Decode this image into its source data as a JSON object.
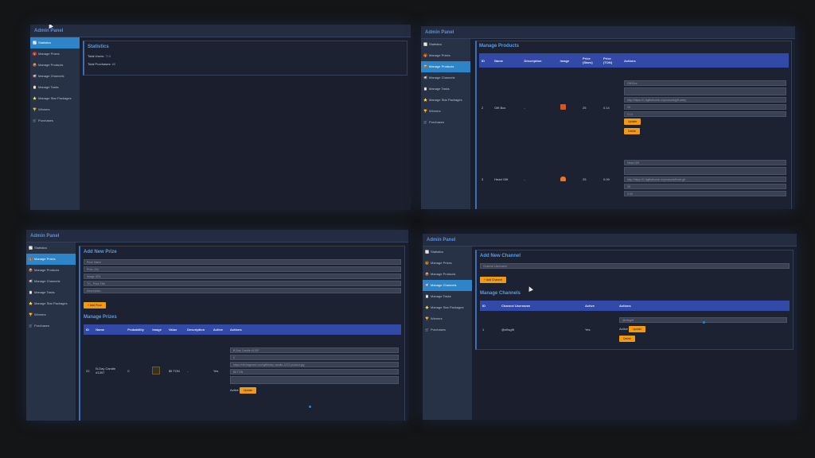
{
  "app_title": "Admin Panel",
  "sidebar": [
    {
      "icon": "chart-icon",
      "glyph": "📈",
      "label": "Statistics"
    },
    {
      "icon": "gift-icon",
      "glyph": "🎁",
      "label": "Manage Prizes"
    },
    {
      "icon": "box-icon",
      "glyph": "📦",
      "label": "Manage Products"
    },
    {
      "icon": "megaphone-icon",
      "glyph": "📢",
      "label": "Manage Channels"
    },
    {
      "icon": "tasks-icon",
      "glyph": "📋",
      "label": "Manage Tasks"
    },
    {
      "icon": "star-icon",
      "glyph": "⭐",
      "label": "Manage Star Packages"
    },
    {
      "icon": "trophy-icon",
      "glyph": "🏆",
      "label": "Winners"
    },
    {
      "icon": "cart-icon",
      "glyph": "🛒",
      "label": "Purchases"
    }
  ],
  "statistics": {
    "title": "Statistics",
    "total_users_label": "Total Users:",
    "total_users_value": "713",
    "total_purchases_label": "Total Purchases:",
    "total_purchases_value": "85"
  },
  "products": {
    "title": "Manage Products",
    "columns": [
      "ID",
      "Name",
      "Description",
      "Image",
      "Price (Stars)",
      "Price (TON)",
      "Actions"
    ],
    "rows": [
      {
        "id": "2",
        "name": "Gift Box",
        "description": "-",
        "image": "gift-icon",
        "price_stars": "25",
        "price_ton": "0.14",
        "inputs": [
          "Gift Box",
          "",
          "http://https://i1.tlgiftsthumb.ru/products/gift.webp",
          "25",
          "0.14"
        ],
        "update_label": "Update",
        "delete_label": "Delete"
      },
      {
        "id": "3",
        "name": "Heart Gift",
        "description": "-",
        "image": "heart-icon",
        "price_stars": "25",
        "price_ton": "0.09",
        "inputs": [
          "Heart Gift",
          "",
          "http://https://i1.tlgiftsthumb.ru/products/heart.gif",
          "25",
          "0.09"
        ]
      }
    ]
  },
  "prizes": {
    "add_title": "Add New Prize",
    "placeholders": [
      "Prize Name",
      "Prob. (%)",
      "Image URL",
      "TG_ Prize Title",
      "Description"
    ],
    "add_button": "+ Add Prize",
    "manage_title": "Manage Prizes",
    "columns": [
      "ID",
      "Name",
      "Probability",
      "Image",
      "Value",
      "Description",
      "Active",
      "Actions"
    ],
    "rows": [
      {
        "id": "22",
        "name": "B-Day Candle #1397",
        "probability": "0",
        "value": "$5 TON",
        "description": "-",
        "active": "Yes",
        "inputs": [
          "B-Day Candle #1397",
          "0",
          "https://nft.fragment.com/gift/bday candle-1372 product.jpg",
          "$5 TON",
          ""
        ],
        "active_label": "Active",
        "update_label": "Update"
      }
    ]
  },
  "channels": {
    "add_title": "Add New Channel",
    "placeholder": "Channel Username",
    "add_button": "+ Add Channel",
    "manage_title": "Manage Channels",
    "columns": [
      "ID",
      "Channel Username",
      "Active",
      "Actions"
    ],
    "rows": [
      {
        "id": "1",
        "username": "@nftsgift",
        "active": "Yes",
        "input": "@nftsgift",
        "active_label": "Active",
        "update_label": "Update",
        "delete_label": "Delete"
      }
    ]
  }
}
